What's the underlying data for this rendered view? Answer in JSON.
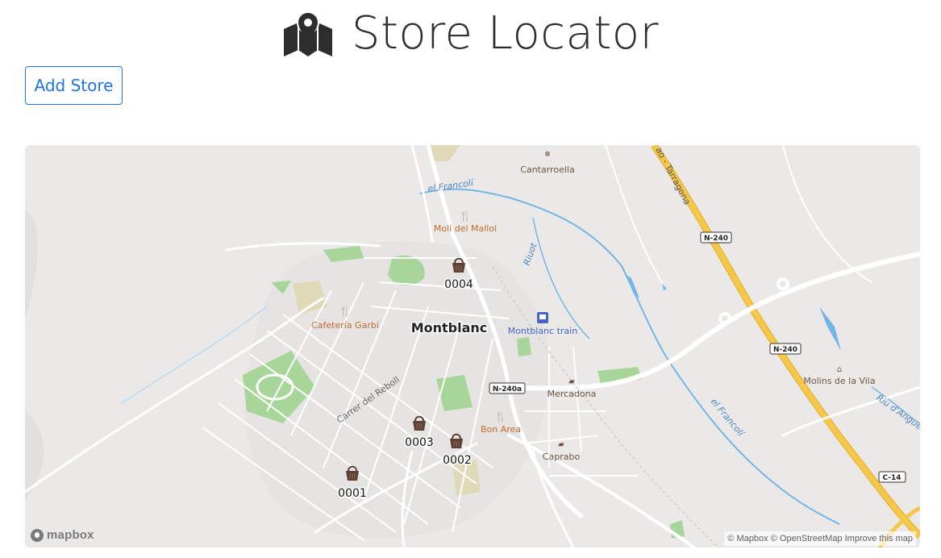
{
  "app": {
    "title": "Store Locator",
    "logo_icon": "map-marker-icon"
  },
  "toolbar": {
    "add_store_label": "Add Store"
  },
  "map": {
    "attribution": {
      "mapbox": "© Mapbox",
      "osm": "© OpenStreetMap",
      "improve": "Improve this map"
    },
    "logo_text": "mapbox",
    "stores": [
      {
        "id": "0001",
        "icon": "shopping-basket-icon"
      },
      {
        "id": "0002",
        "icon": "shopping-basket-icon"
      },
      {
        "id": "0003",
        "icon": "shopping-basket-icon"
      },
      {
        "id": "0004",
        "icon": "shopping-basket-icon"
      }
    ],
    "places": {
      "town": "Montblanc",
      "cantarroella": "Cantarroella",
      "moli": "Molí del Mallol",
      "cafeteria": "Cafetería Garbí",
      "train": "Montblanc train",
      "mercadona": "Mercadona",
      "bon_area": "Bon Area",
      "caprabo": "Caprabo",
      "molins": "Molins de la Vila",
      "francoli_1": "el Francolí",
      "francoli_2": "el Francolí",
      "riuot": "Riuot",
      "riu_anguera": "Riu d'Angue",
      "carrer": "Carrer del Reboll",
      "highway": "ao - Tarragona"
    },
    "road_shields": {
      "n240_a": "N-240",
      "n240_b": "N-240",
      "n240a": "N-240a",
      "c14": "C-14"
    },
    "colors": {
      "land": "#ebe9e7",
      "road": "#ffffff",
      "highway": "#f5c84b",
      "water": "#73b6e6",
      "park": "#a8d69a",
      "poi_orange": "#c46a2c",
      "poi_brown": "#6f5442",
      "transit_blue": "#4766c4",
      "store_brown": "#5d4033"
    }
  }
}
